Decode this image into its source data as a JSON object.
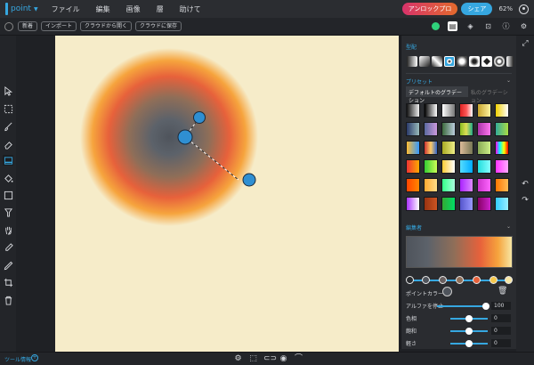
{
  "app": {
    "logo_text": "point",
    "menu": [
      "ファイル",
      "編集",
      "画像",
      "層",
      "助けて"
    ],
    "unlock_label": "アンロックプロ",
    "share_label": "シェア",
    "zoom": "62%"
  },
  "toolbar2": {
    "reset_label": "新着",
    "import_label": "インポート",
    "open_cloud_label": "クラウドから開く",
    "save_cloud_label": "クラウドに保存"
  },
  "panel": {
    "type_heading": "型配",
    "preset_heading": "プリセット",
    "preset_tabs": [
      "デフォルトのグラデーション",
      "私のグラデーション"
    ],
    "editor_heading": "編集者",
    "point_color_label": "ポイントカラー",
    "properties": [
      {
        "label": "アルファを停止",
        "value": "100",
        "fraction": 1.0
      },
      {
        "label": "色相",
        "value": "0",
        "fraction": 0.5
      },
      {
        "label": "飽和",
        "value": "0",
        "fraction": 0.5
      },
      {
        "label": "軽さ",
        "value": "0",
        "fraction": 0.5
      }
    ]
  },
  "status": {
    "tool_info_label": "ツール情報"
  },
  "colors": {
    "accent": "#36a7e0",
    "canvas_bg": "#f6ecc9",
    "gradient_stops": [
      "#4f545c",
      "#5c626a",
      "#8f6e58",
      "#e7613b",
      "#f6a43d",
      "#f7e6a4"
    ]
  }
}
